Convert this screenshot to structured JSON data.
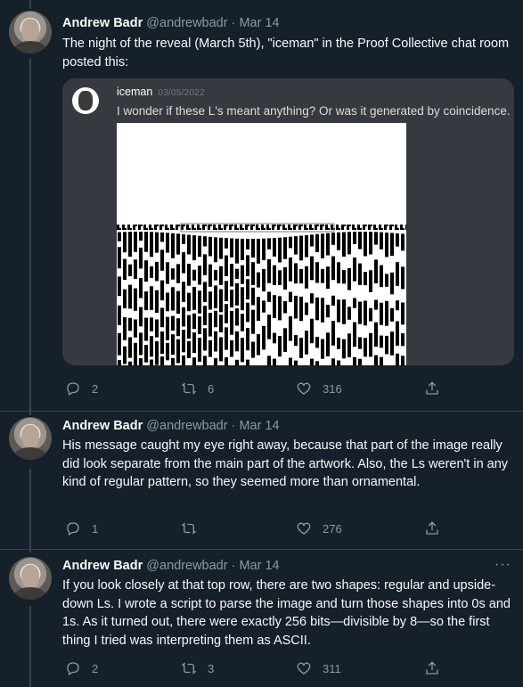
{
  "colors": {
    "background": "#15202b",
    "text": "#f7f9f9",
    "muted": "#8b98a5",
    "divider": "#38444d"
  },
  "tweets": [
    {
      "name": "Andrew Badr",
      "handle": "@andrewbadr",
      "date": "· Mar 14",
      "text": "The night of the reveal (March 5th), \"iceman\" in the Proof Collective chat room posted this:",
      "embed": {
        "username": "iceman",
        "date": "03/05/2022",
        "message": "I wonder if these L's meant anything? Or was it generated by coincidence."
      },
      "replies": "2",
      "retweets": "6",
      "likes": "316"
    },
    {
      "name": "Andrew Badr",
      "handle": "@andrewbadr",
      "date": "· Mar 14",
      "text": "His message caught my eye right away, because that part of the image really did look separate from the main part of the artwork. Also, the Ls weren't in any kind of regular pattern, so they seemed more than ornamental.",
      "replies": "1",
      "retweets": "",
      "likes": "276"
    },
    {
      "name": "Andrew Badr",
      "handle": "@andrewbadr",
      "date": "· Mar 14",
      "text": "If you look closely at that top row, there are two shapes: regular and upside-down Ls. I wrote a script to parse the image and turn those shapes into 0s and 1s. As it turned out, there were exactly 256 bits—divisible by 8—so the first thing I tried was interpreting them as ASCII.",
      "replies": "2",
      "retweets": "3",
      "likes": "311"
    }
  ],
  "icons": [
    "reply-icon",
    "retweet-icon",
    "like-icon",
    "share-icon",
    "more-icon"
  ]
}
